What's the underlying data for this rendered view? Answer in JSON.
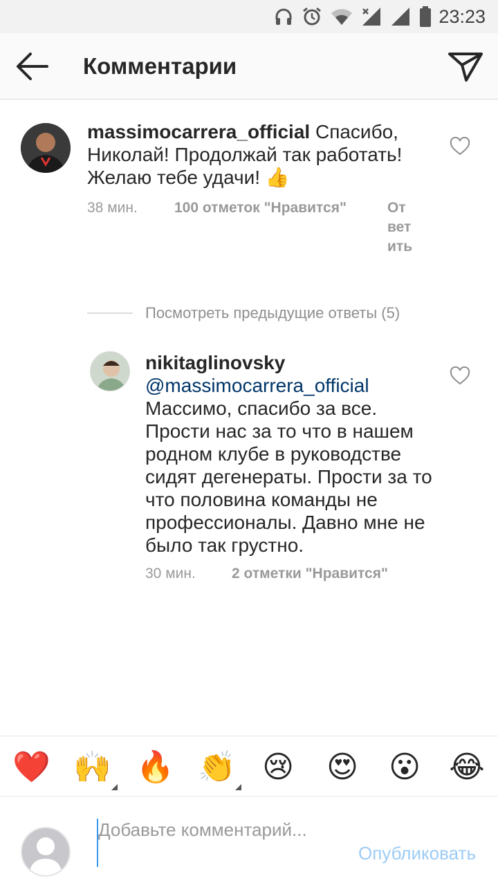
{
  "status_bar": {
    "time": "23:23",
    "icons": [
      "headphones-icon",
      "alarm-icon",
      "wifi-icon",
      "signal-icon",
      "signal-icon",
      "battery-icon"
    ]
  },
  "header": {
    "title": "Комментарии",
    "back_icon": "arrow-left-icon",
    "share_icon": "paper-plane-icon"
  },
  "comments": [
    {
      "username": "massimocarrera_official",
      "text": "Спасибо, Николай! Продолжай так работать! Желаю тебе удачи! 👍",
      "time": "38 мин.",
      "likes": "100 отметок \"Нравится\"",
      "reply": "Ответить"
    },
    {
      "username": "nikitaglinovsky",
      "mention": "@massimocarrera_official",
      "text": "Массимо, спасибо за все. Прости нас за то что в нашем родном клубе в руководстве сидят дегенераты. Прости за то что половина команды не профессионалы. Давно мне не было так грустно.",
      "time": "30 мин.",
      "likes": "2 отметки \"Нравится\""
    }
  ],
  "view_previous": "Посмотреть предыдущие ответы (5)",
  "emoji_bar": [
    "❤️",
    "🙌",
    "🔥",
    "👏",
    "😢",
    "😍",
    "😮",
    "😂"
  ],
  "composer": {
    "placeholder": "Добавьте комментарий...",
    "publish": "Опубликовать"
  },
  "colors": {
    "mention": "#003569",
    "publish_disabled": "#9ccbf5",
    "meta": "#999999"
  }
}
